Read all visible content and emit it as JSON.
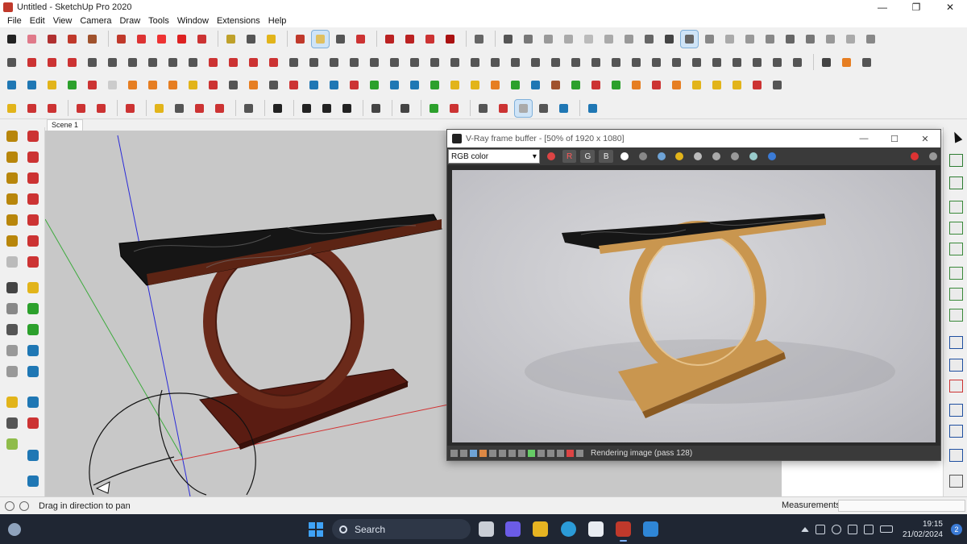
{
  "window": {
    "title": "Untitled - SketchUp Pro 2020",
    "minimize": "—",
    "maximize": "❐",
    "close": "✕"
  },
  "menu": [
    "File",
    "Edit",
    "View",
    "Camera",
    "Draw",
    "Tools",
    "Window",
    "Extensions",
    "Help"
  ],
  "scene": {
    "tab_label": "Scene 1"
  },
  "vray": {
    "title": "V-Ray frame buffer - [50% of 1920 x 1080]",
    "minimize": "—",
    "maximize": "☐",
    "close": "✕",
    "channel_value": "RGB color",
    "channel_arrow": "▾",
    "btn_r": "R",
    "btn_g": "G",
    "btn_b": "B",
    "status_text": "Rendering image (pass 128)"
  },
  "status": {
    "hint": "Drag in direction to pan",
    "measurements_label": "Measurements"
  },
  "taskbar": {
    "search_placeholder": "Search",
    "time": "19:15",
    "date": "21/02/2024",
    "notification_count": "2"
  },
  "colors": {
    "accent": "#c0392b",
    "toolbar_bg": "#f0f0f0",
    "viewport_bg": "#c8c8c8",
    "vray_bg": "#2b2b2b",
    "taskbar_bg": "#1f2633",
    "marble": "#1a1a1a",
    "wood": "#6b2a1a",
    "gold": "#c9964f"
  }
}
